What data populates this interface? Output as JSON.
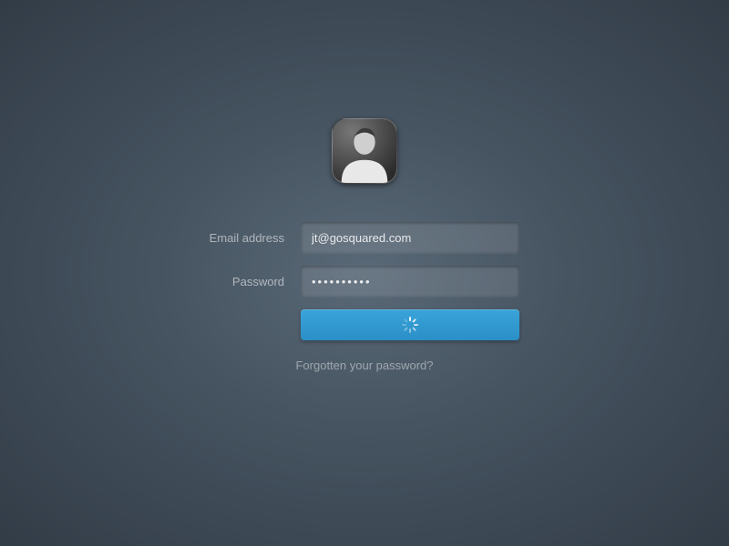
{
  "form": {
    "email_label": "Email address",
    "email_value": "jt@gosquared.com",
    "password_label": "Password",
    "password_masked": "••••••••••"
  },
  "links": {
    "forgot": "Forgotten your password?"
  },
  "colors": {
    "accent": "#2f96cf"
  }
}
